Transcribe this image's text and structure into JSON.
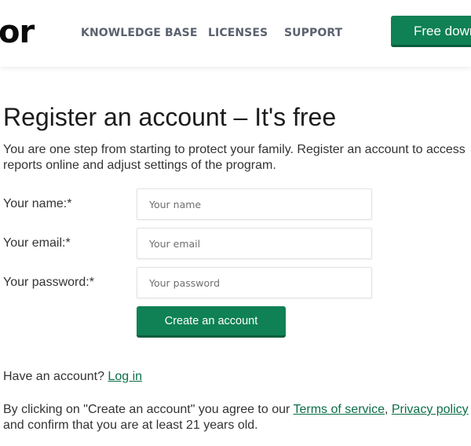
{
  "header": {
    "logo_text": "or",
    "nav": [
      {
        "label": "KNOWLEDGE BASE"
      },
      {
        "label": "LICENSES"
      },
      {
        "label": "SUPPORT"
      }
    ],
    "cta_label": "Free download"
  },
  "page": {
    "title": "Register an account – It's free",
    "intro": "You are one step from starting to protect your family. Register an account to access reports online and adjust settings of the program."
  },
  "form": {
    "fields": [
      {
        "label": "Your name:*",
        "placeholder": "Your name",
        "value": ""
      },
      {
        "label": "Your email:*",
        "placeholder": "Your email",
        "value": ""
      },
      {
        "label": "Your password:*",
        "placeholder": "Your password",
        "value": ""
      }
    ],
    "submit_label": "Create an account"
  },
  "footer": {
    "have_account_text": "Have an account? ",
    "login_link": "Log in",
    "terms_prefix": "By clicking on \"Create an account\" you agree to our ",
    "terms_link": "Terms of service",
    "terms_sep": ", ",
    "privacy_link": "Privacy policy",
    "terms_line2": "and confirm that you are at least 21 years old."
  },
  "colors": {
    "primary": "#0f8154",
    "primary_dark": "#0a5e3c",
    "link": "#0b6e46",
    "nav_text": "#5a6270"
  }
}
